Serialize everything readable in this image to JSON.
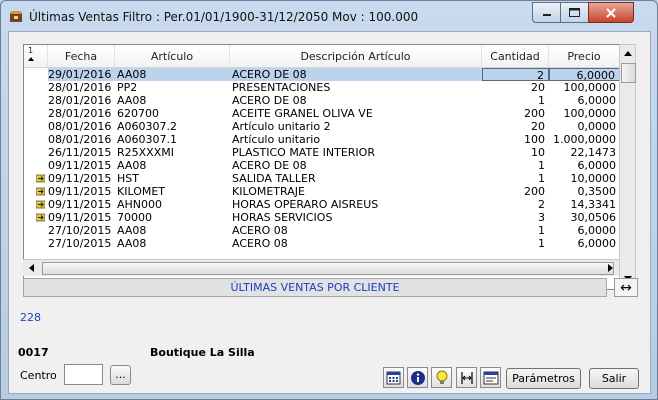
{
  "window": {
    "title": "Últimas Ventas Filtro : Per.01/01/1900-31/12/2050 Mov : 100.000",
    "colors": {
      "title_close_btn": "#c9452e",
      "link_blue": "#1a3fc3",
      "selection": "#bcd3ec"
    }
  },
  "grid": {
    "sort_indicator": "1",
    "columns": [
      "Fecha",
      "Artículo",
      "Descripción Artículo",
      "Cantidad",
      "Precio"
    ],
    "rows": [
      {
        "fecha": "29/01/2016",
        "articulo": "AA08",
        "descripcion": "ACERO DE 08",
        "cantidad": "2",
        "precio": "6,0000",
        "icon": "",
        "selected": true
      },
      {
        "fecha": "28/01/2016",
        "articulo": "PP2",
        "descripcion": "PRESENTACIONES",
        "cantidad": "20",
        "precio": "100,0000",
        "icon": ""
      },
      {
        "fecha": "28/01/2016",
        "articulo": "AA08",
        "descripcion": "ACERO DE 08",
        "cantidad": "1",
        "precio": "6,0000",
        "icon": ""
      },
      {
        "fecha": "28/01/2016",
        "articulo": "620700",
        "descripcion": "ACEITE GRANEL OLIVA VE",
        "cantidad": "200",
        "precio": "100,0000",
        "icon": ""
      },
      {
        "fecha": "08/01/2016",
        "articulo": "A060307.2",
        "descripcion": "Artículo unitario 2",
        "cantidad": "20",
        "precio": "0,0000",
        "icon": ""
      },
      {
        "fecha": "08/01/2016",
        "articulo": "A060307.1",
        "descripcion": "Artículo unitario",
        "cantidad": "100",
        "precio": "1.000,0000",
        "icon": ""
      },
      {
        "fecha": "26/11/2015",
        "articulo": "R25XXXMI",
        "descripcion": "PLASTICO MATE INTERIOR",
        "cantidad": "10",
        "precio": "22,1473",
        "icon": ""
      },
      {
        "fecha": "09/11/2015",
        "articulo": "AA08",
        "descripcion": "ACERO DE 08",
        "cantidad": "1",
        "precio": "6,0000",
        "icon": ""
      },
      {
        "fecha": "09/11/2015",
        "articulo": "HST",
        "descripcion": "SALIDA TALLER",
        "cantidad": "1",
        "precio": "10,0000",
        "icon": "folder-arrow-icon"
      },
      {
        "fecha": "09/11/2015",
        "articulo": "KILOMET",
        "descripcion": "KILOMETRAJE",
        "cantidad": "200",
        "precio": "0,3500",
        "icon": "folder-arrow-icon"
      },
      {
        "fecha": "09/11/2015",
        "articulo": "AHN000",
        "descripcion": "HORAS OPERARO AISREUS",
        "cantidad": "2",
        "precio": "14,3341",
        "icon": "folder-arrow-icon"
      },
      {
        "fecha": "09/11/2015",
        "articulo": "70000",
        "descripcion": "HORAS SERVICIOS",
        "cantidad": "3",
        "precio": "30,0506",
        "icon": "folder-arrow-icon"
      },
      {
        "fecha": "27/10/2015",
        "articulo": "AA08",
        "descripcion": "ACERO 08",
        "cantidad": "1",
        "precio": "6,0000",
        "icon": ""
      },
      {
        "fecha": "27/10/2015",
        "articulo": "AA08",
        "descripcion": "ACERO 08",
        "cantidad": "1",
        "precio": "6,0000",
        "icon": ""
      }
    ]
  },
  "caption": "ÚLTIMAS VENTAS POR CLIENTE",
  "record_count": "228",
  "client": {
    "code": "0017",
    "name": "Boutique La Silla"
  },
  "centro": {
    "label": "Centro",
    "value": "",
    "browse_label": "..."
  },
  "toolbar": {
    "icons": [
      "calendar-icon",
      "info-icon",
      "lightbulb-icon",
      "column-width-icon",
      "form-icon"
    ],
    "parametros_label": "Parámetros",
    "salir_label": "Salir"
  }
}
